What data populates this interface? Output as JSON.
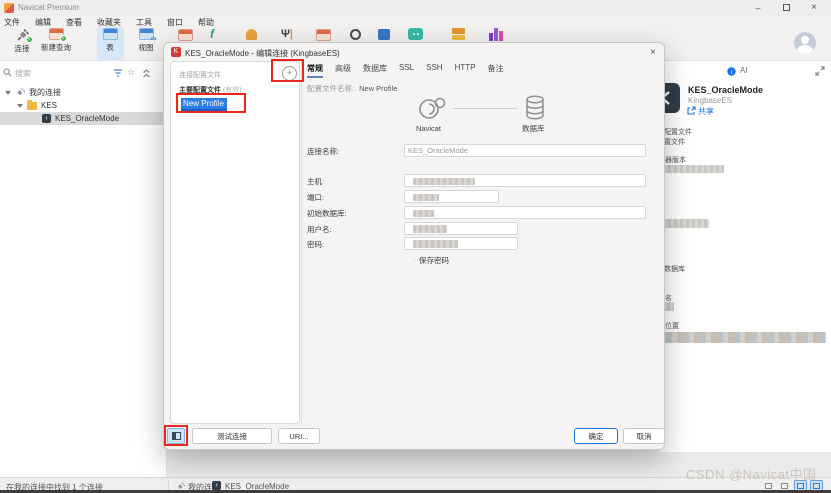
{
  "window": {
    "title": "Navicat Premium"
  },
  "menu": {
    "items": [
      "文件",
      "编辑",
      "查看",
      "收藏夹",
      "工具",
      "窗口",
      "帮助"
    ]
  },
  "toolbar": {
    "connection": "连接",
    "new_query": "新建查询",
    "table": "表",
    "view": "视图"
  },
  "sidebar": {
    "search_placeholder": "搜索",
    "tree": {
      "root": "我的连接",
      "folder": "KES",
      "connection": "KES_OracleMode"
    }
  },
  "dialog": {
    "title": "KES_OracleMode - 编辑连接 (KingbaseES)",
    "close": "×",
    "profiles": {
      "header": "连接配置文件",
      "add": "+",
      "primary_label": "主要配置文件",
      "primary_suffix": "(有效)",
      "selected_profile": "New Profile"
    },
    "tabs": [
      "常规",
      "高级",
      "数据库",
      "SSL",
      "SSH",
      "HTTP",
      "备注"
    ],
    "profile_name_label": "配置文件名称:",
    "profile_name_value": "New Profile",
    "diagram": {
      "left_caption": "Navicat",
      "right_caption": "数据库"
    },
    "fields": {
      "name_label": "连接名称:",
      "name_value": "KES_OracleMode",
      "host_label": "主机:",
      "port_label": "端口:",
      "initdb_label": "初始数据库:",
      "user_label": "用户名:",
      "password_label": "密码:",
      "save_password_label": "保存密码"
    },
    "buttons": {
      "test": "测试连接",
      "uri": "URI...",
      "ok": "确定",
      "cancel": "取消"
    }
  },
  "info_panel": {
    "tab_ai": "AI",
    "title": "KES_OracleMode",
    "subtitle": "KingbaseES",
    "share": "共享",
    "sections": {
      "profile1": "配置文件",
      "profile2": "置文件",
      "server_version": "器版本",
      "database": "数据库",
      "name": "名",
      "location": "位置"
    }
  },
  "status_bar": {
    "left": "在我的连接中找到 1 个连接",
    "breadcrumb_root": "我的连接",
    "breadcrumb_item": "KES_OracleMode"
  },
  "watermark": "CSDN @Navicat中国",
  "colors": {
    "accent": "#1673e6",
    "annotation": "#e8261d",
    "selection": "#2c7ce8",
    "toolbar_active": "#d5e7f8"
  }
}
